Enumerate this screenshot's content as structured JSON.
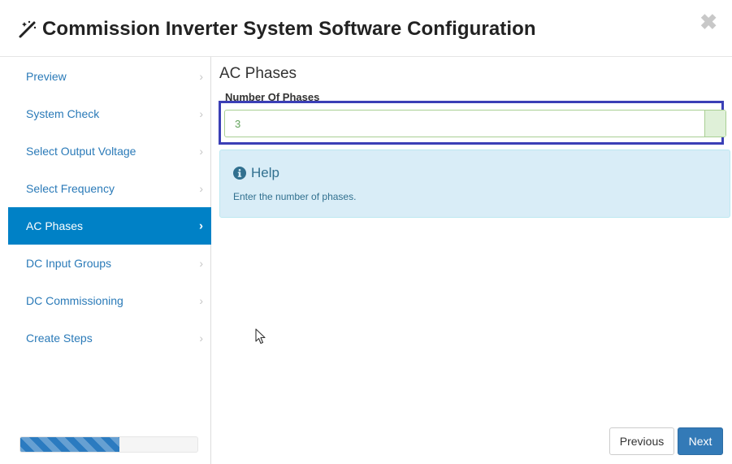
{
  "dialog": {
    "title": "Commission Inverter System Software Configuration",
    "close_glyph": "✖"
  },
  "sidebar": {
    "items": [
      {
        "label": "Preview",
        "active": false
      },
      {
        "label": "System Check",
        "active": false
      },
      {
        "label": "Select Output Voltage",
        "active": false
      },
      {
        "label": "Select Frequency",
        "active": false
      },
      {
        "label": "AC Phases",
        "active": true
      },
      {
        "label": "DC Input Groups",
        "active": false
      },
      {
        "label": "DC Commissioning",
        "active": false
      },
      {
        "label": "Create Steps",
        "active": false
      }
    ],
    "chevron": "›",
    "progress_fraction": 0.56
  },
  "main": {
    "section_title": "AC Phases",
    "field_label": "Number Of Phases",
    "field_value": "3",
    "help": {
      "title": "Help",
      "text": "Enter the number of phases."
    }
  },
  "footer": {
    "previous_label": "Previous",
    "next_label": "Next"
  },
  "colors": {
    "accent": "#0081c6",
    "link": "#2a7ab8",
    "highlight_border": "#3b3fb6",
    "help_bg": "#d9edf7",
    "primary_button": "#337ab7"
  }
}
